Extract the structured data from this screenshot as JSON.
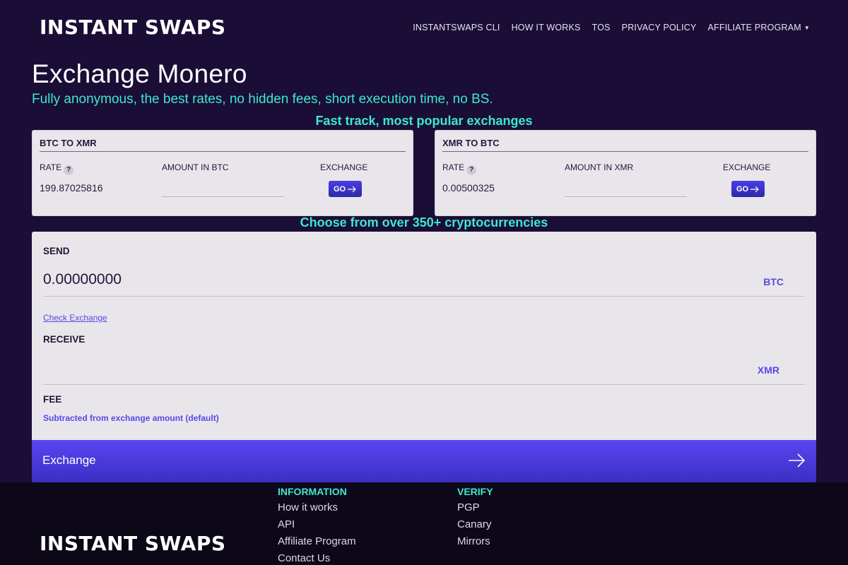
{
  "nav": {
    "brand": "INSTANT SWAPS",
    "links": [
      "INSTANTSWAPS CLI",
      "HOW IT WORKS",
      "TOS",
      "PRIVACY POLICY",
      "AFFILIATE PROGRAM"
    ]
  },
  "hero": {
    "title": "Exchange Monero",
    "subtitle": "Fully anonymous, the best rates, no hidden fees, short execution time, no BS."
  },
  "fast_track": {
    "heading": "Fast track, most popular exchanges",
    "cards": [
      {
        "title": "BTC TO XMR",
        "rate_label": "RATE",
        "rate_value": "199.87025816",
        "amount_label": "AMOUNT IN BTC",
        "exchange_label": "EXCHANGE",
        "go_label": "GO"
      },
      {
        "title": "XMR TO BTC",
        "rate_label": "RATE",
        "rate_value": "0.00500325",
        "amount_label": "AMOUNT IN XMR",
        "exchange_label": "EXCHANGE",
        "go_label": "GO"
      }
    ]
  },
  "converter": {
    "heading": "Choose from over 350+ cryptocurrencies",
    "send_label": "SEND",
    "send_value": "0.00000000",
    "send_currency": "BTC",
    "check_link": "Check Exchange",
    "receive_label": "RECEIVE",
    "receive_value": "",
    "receive_currency": "XMR",
    "fee_label": "FEE",
    "fee_desc": "Subtracted from exchange amount (default)",
    "exchange_button": "Exchange"
  },
  "footer": {
    "brand": "INSTANT SWAPS",
    "information": {
      "title": "INFORMATION",
      "links": [
        "How it works",
        "API",
        "Affiliate Program",
        "Contact Us"
      ]
    },
    "verify": {
      "title": "VERIFY",
      "links": [
        "PGP",
        "Canary",
        "Mirrors"
      ]
    }
  },
  "colors": {
    "background": "#1a0d36",
    "accent_teal": "#3de8cf",
    "accent_purple": "#5848e5",
    "card": "#e9e6eb"
  }
}
